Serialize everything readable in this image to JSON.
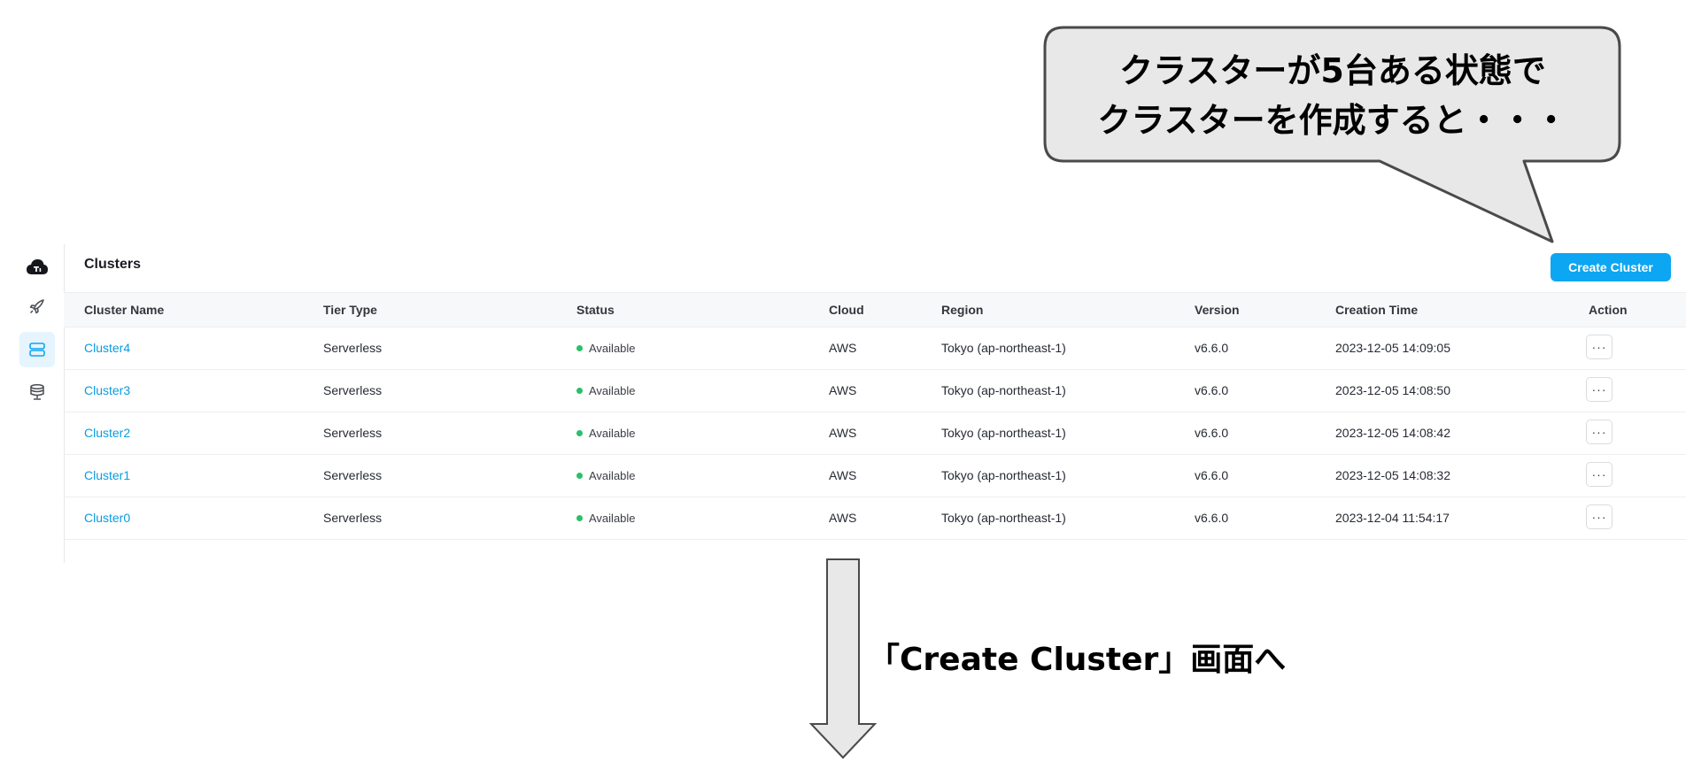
{
  "callout": {
    "line1": "クラスターが5台ある状態で",
    "line2": "クラスターを作成すると・・・"
  },
  "sidebar": {
    "icons": [
      "cloud-logo-icon",
      "rocket-icon",
      "clusters-icon",
      "database-icon"
    ],
    "active": "clusters-icon"
  },
  "header": {
    "title": "Clusters",
    "create_button": "Create Cluster"
  },
  "table": {
    "columns": [
      "Cluster Name",
      "Tier Type",
      "Status",
      "Cloud",
      "Region",
      "Version",
      "Creation Time",
      "Action"
    ],
    "rows": [
      {
        "name": "Cluster4",
        "tier": "Serverless",
        "status": "Available",
        "cloud": "AWS",
        "region": "Tokyo (ap-northeast-1)",
        "version": "v6.6.0",
        "created": "2023-12-05 14:09:05",
        "action": "···"
      },
      {
        "name": "Cluster3",
        "tier": "Serverless",
        "status": "Available",
        "cloud": "AWS",
        "region": "Tokyo (ap-northeast-1)",
        "version": "v6.6.0",
        "created": "2023-12-05 14:08:50",
        "action": "···"
      },
      {
        "name": "Cluster2",
        "tier": "Serverless",
        "status": "Available",
        "cloud": "AWS",
        "region": "Tokyo (ap-northeast-1)",
        "version": "v6.6.0",
        "created": "2023-12-05 14:08:42",
        "action": "···"
      },
      {
        "name": "Cluster1",
        "tier": "Serverless",
        "status": "Available",
        "cloud": "AWS",
        "region": "Tokyo (ap-northeast-1)",
        "version": "v6.6.0",
        "created": "2023-12-05 14:08:32",
        "action": "···"
      },
      {
        "name": "Cluster0",
        "tier": "Serverless",
        "status": "Available",
        "cloud": "AWS",
        "region": "Tokyo (ap-northeast-1)",
        "version": "v6.6.0",
        "created": "2023-12-04 11:54:17",
        "action": "···"
      }
    ]
  },
  "arrow_label": "「Create Cluster」画面へ",
  "colors": {
    "accent": "#0ca6f2",
    "link": "#0a9ce0",
    "status_available": "#2bbf6a",
    "callout_fill": "#e8e8e8",
    "callout_border": "#4a4a4a"
  }
}
